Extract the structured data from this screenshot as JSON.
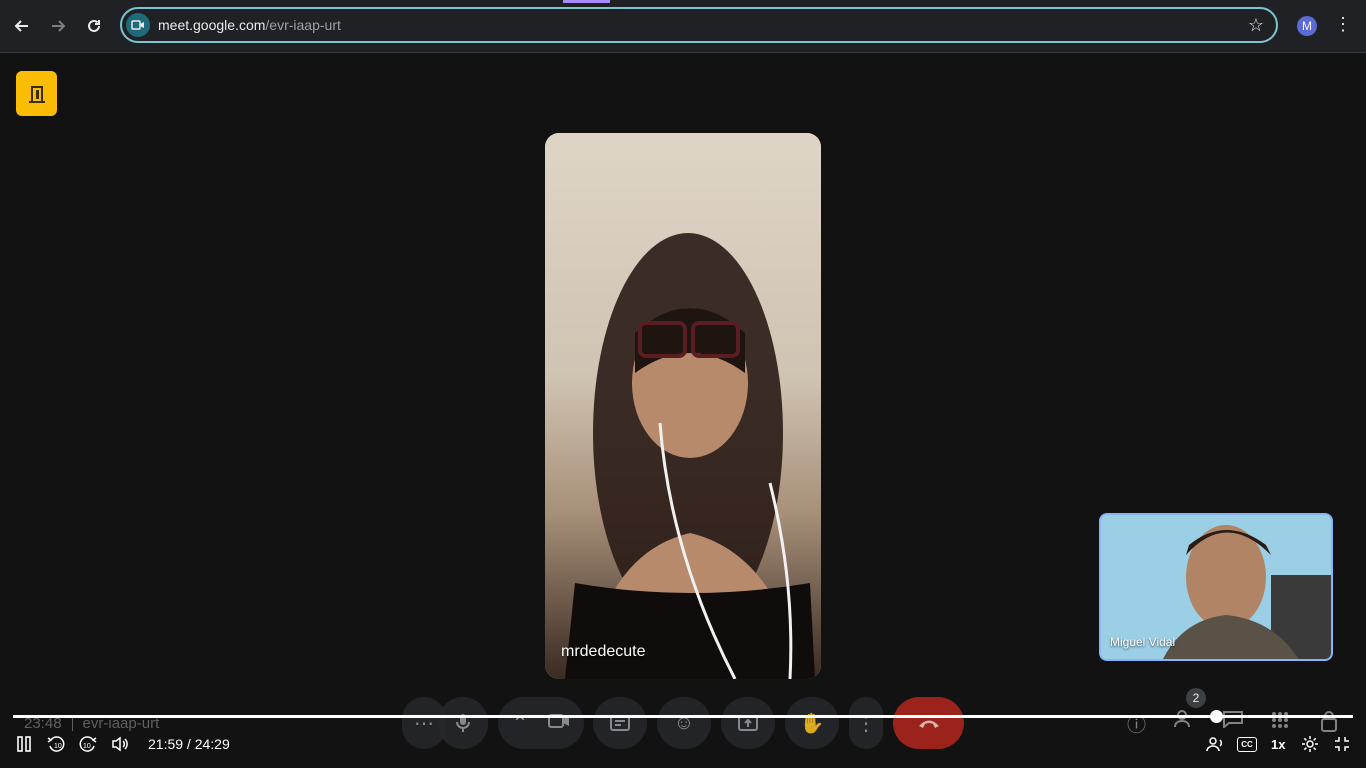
{
  "browser": {
    "url_host": "meet.google.com",
    "url_path": "/evr-iaap-urt",
    "profile_initial": "M",
    "icons": [
      "back-arrow-icon",
      "forward-arrow-icon",
      "reload-icon",
      "meet-site-icon",
      "star-icon",
      "more-vert-icon"
    ]
  },
  "meeting": {
    "main_participant": "mrdedecute",
    "pip_participant": "Miguel Vidal",
    "clock": "23:48",
    "code": "evr-iaap-urt",
    "participant_count": "2"
  },
  "player": {
    "current_time": "21:59",
    "duration": "24:29",
    "time_display": "21:59 / 24:29",
    "progress": 0.898,
    "speed": "1x",
    "cc_label": "CC"
  },
  "colors": {
    "exit_badge": "#fbbc04",
    "omnibox_border": "#7cc4d2",
    "end_call": "#b3261e",
    "pip_border": "#8ab4f8"
  }
}
